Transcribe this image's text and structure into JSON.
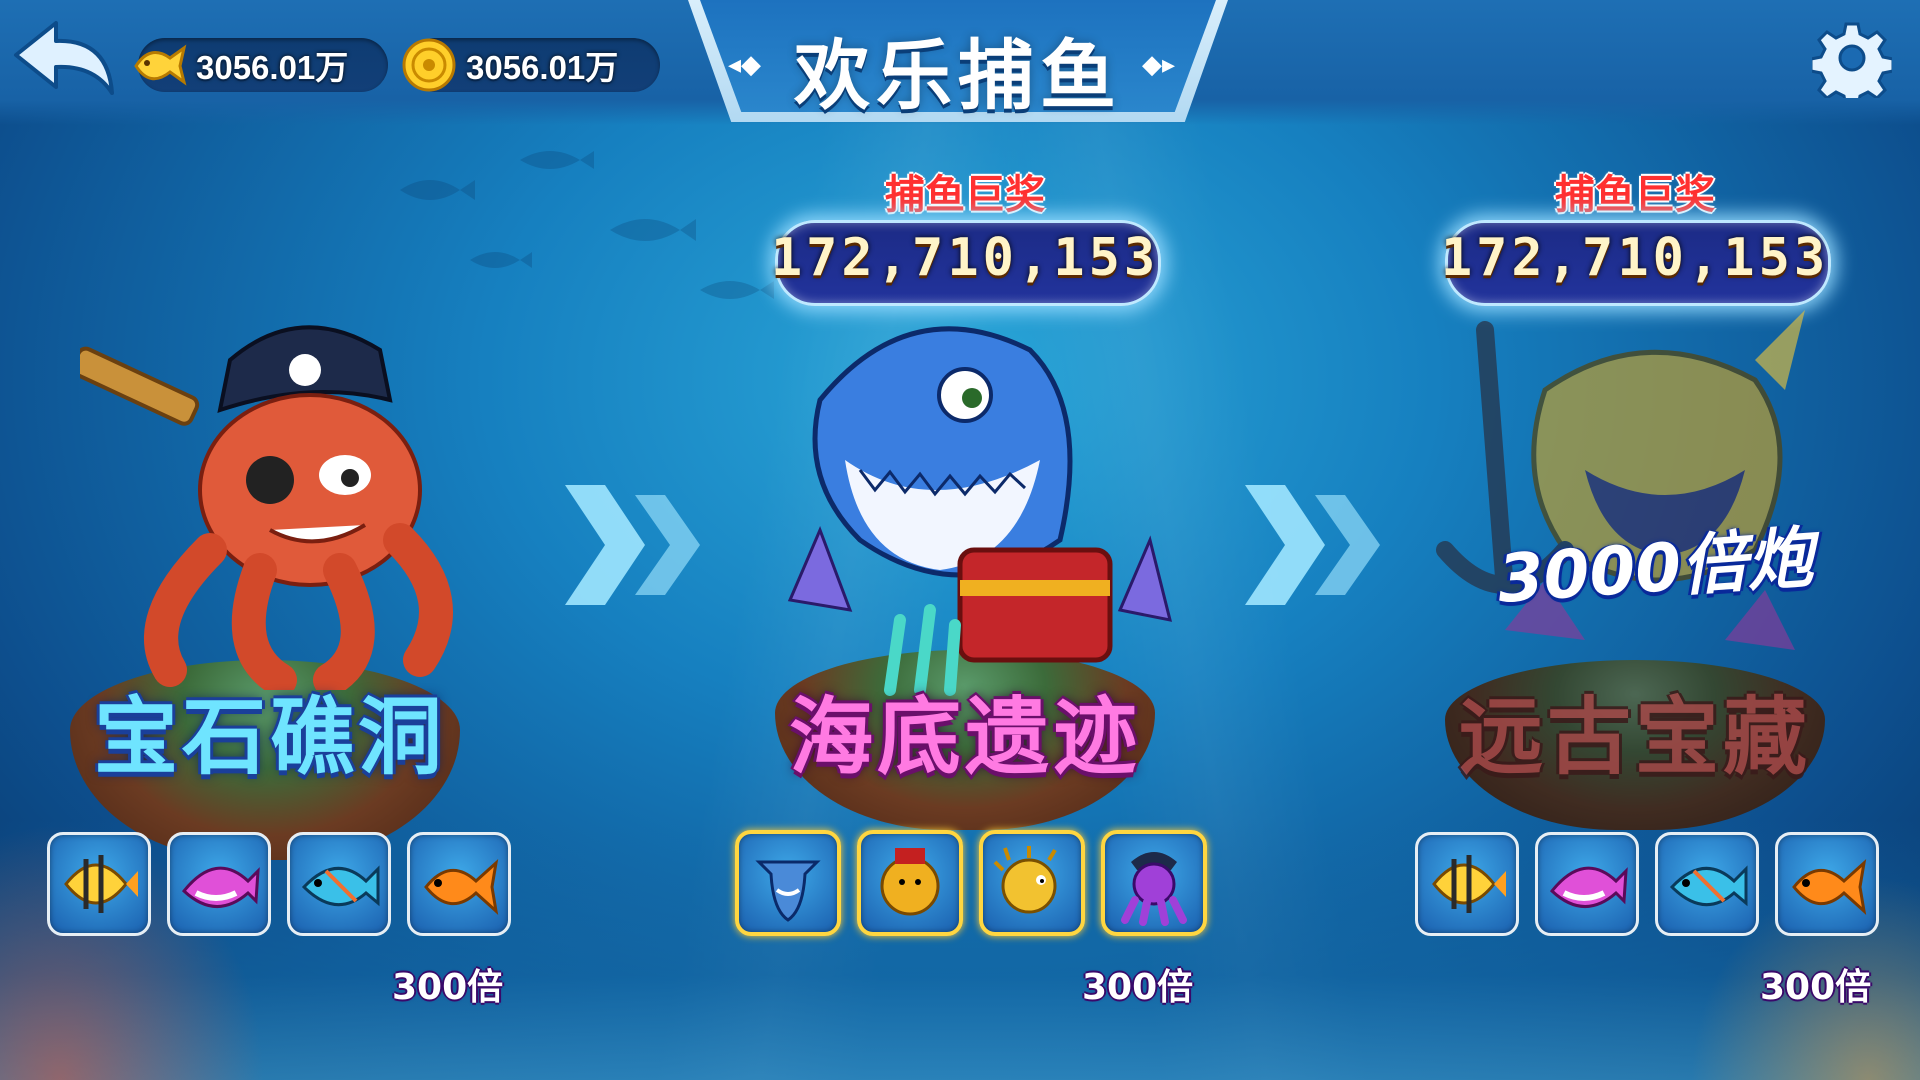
{
  "header": {
    "title": "欢乐捕鱼",
    "fish_currency": "3056.01万",
    "gold_currency": "3056.01万"
  },
  "rooms": [
    {
      "name": "宝石礁洞",
      "multiplier": "300倍",
      "name_color": "#4fd6ff",
      "fish": [
        "angelfish-icon",
        "pink-fish-icon",
        "blue-fish-icon",
        "goldfish-icon"
      ]
    },
    {
      "name": "海底遗迹",
      "multiplier": "300倍",
      "name_color": "#f36bd8",
      "jackpot_label": "捕鱼巨奖",
      "jackpot_value": "172,710,153",
      "fish": [
        "hammerhead-shark-icon",
        "fortune-god-icon",
        "golden-pufferfish-icon",
        "pirate-octopus-icon"
      ]
    },
    {
      "name": "远古宝藏",
      "multiplier": "300倍",
      "name_color": "#b54a4a",
      "jackpot_label": "捕鱼巨奖",
      "jackpot_value": "172,710,153",
      "cannon_label": "3000倍炮",
      "fish": [
        "angelfish-icon",
        "pink-fish-icon",
        "blue-fish-icon",
        "goldfish-icon"
      ]
    }
  ]
}
